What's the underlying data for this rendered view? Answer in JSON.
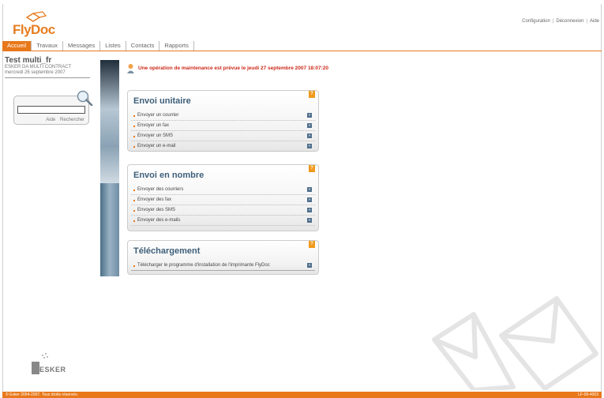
{
  "app": {
    "logo_text": "FlyDoc",
    "company_logo": "ESKER"
  },
  "header": {
    "links": [
      "Configuration",
      "Déconnexion",
      "Aide"
    ]
  },
  "tabs": [
    "Accueil",
    "Travaux",
    "Messages",
    "Listes",
    "Contacts",
    "Rapports"
  ],
  "user": {
    "name": "Test multi_fr",
    "org": "ESKER DA MULTI CONTRACT",
    "date": "mercredi 26 septembre 2007"
  },
  "search": {
    "value": "",
    "help_label": "Aide",
    "search_label": "Rechercher"
  },
  "notice": "Une opération de maintenance est prévue le jeudi 27 septembre 2007 18:07:20",
  "panels": {
    "unit": {
      "title": "Envoi unitaire",
      "items": [
        "Envoyer un courrier",
        "Envoyer un fax",
        "Envoyer un SMS",
        "Envoyer un e-mail"
      ]
    },
    "bulk": {
      "title": "Envoi en nombre",
      "items": [
        "Envoyer des courriers",
        "Envoyer des fax",
        "Envoyer des SMS",
        "Envoyer des e-mails"
      ]
    },
    "download": {
      "title": "Téléchargement",
      "items": [
        "Télécharger le programme d'installation de l'imprimante FlyDoc"
      ]
    },
    "help_glyph": "?",
    "go_glyph": "»"
  },
  "footer": {
    "copyright": "© Esker 2004-2007. Tous droits réservés.",
    "version": "LF-09-4003"
  },
  "colors": {
    "accent": "#e8781a",
    "title": "#3e5f7a",
    "notice": "#cc2a1a"
  },
  "icons": [
    "flydoc-logo-icon",
    "magnifier-icon",
    "warning-person-icon",
    "help-icon",
    "arrow-go-icon",
    "envelope-watermark-icon",
    "esker-logo-icon"
  ]
}
